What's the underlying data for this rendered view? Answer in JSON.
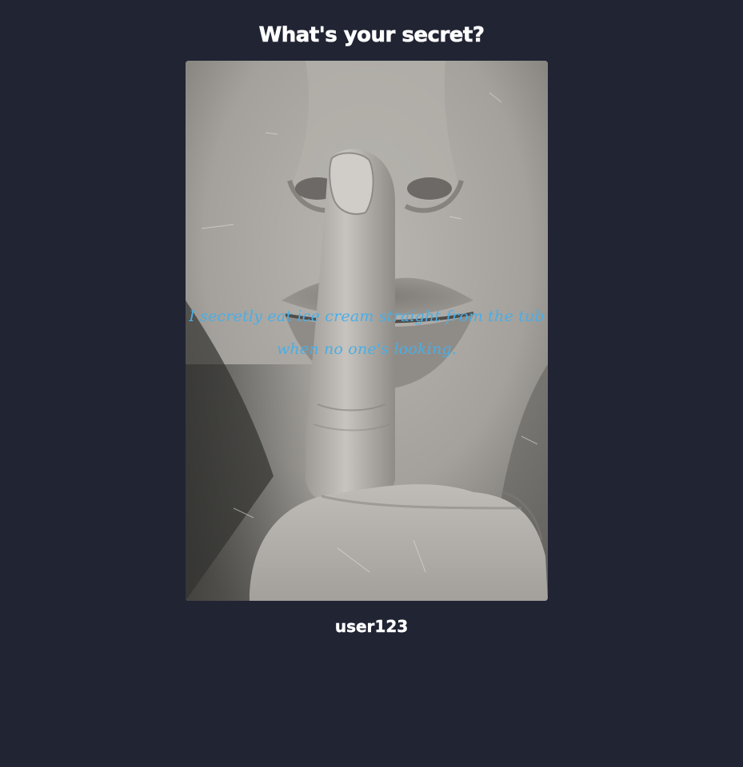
{
  "header": {
    "title": "What's your secret?"
  },
  "post": {
    "image_subject": "black-and-white photo of a person holding a finger to their lips in a shushing gesture",
    "secret_text": "I secretly eat ice cream straight from the tub when no one's looking.",
    "author": "user123"
  },
  "colors": {
    "background": "#212433",
    "title": "#ffffff",
    "secret_text": "#4aaee6",
    "author": "#ffffff"
  }
}
